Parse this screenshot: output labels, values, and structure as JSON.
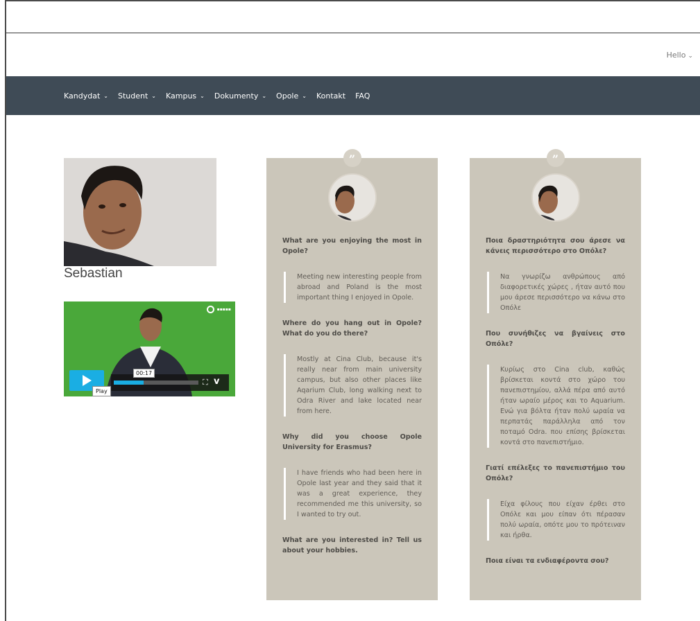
{
  "header": {
    "hello_label": "Hello"
  },
  "nav": {
    "items": [
      {
        "label": "Kandydat",
        "dropdown": true
      },
      {
        "label": "Student",
        "dropdown": true
      },
      {
        "label": "Kampus",
        "dropdown": true
      },
      {
        "label": "Dokumenty",
        "dropdown": true
      },
      {
        "label": "Opole",
        "dropdown": true
      },
      {
        "label": "Kontakt",
        "dropdown": false
      },
      {
        "label": "FAQ",
        "dropdown": false
      }
    ]
  },
  "profile": {
    "name": "Sebastian"
  },
  "video": {
    "time": "00:17",
    "play_tooltip": "Play",
    "progress": 0.35
  },
  "card_en": {
    "items": [
      {
        "q": "What are you enjoying the most in Opole?",
        "a": "Meeting new interesting people from abroad and Poland is the most important thing I enjoyed in Opole."
      },
      {
        "q": "Where do you hang out in Opole? What do you do there?",
        "a": "Mostly at Cina Club, because it's really near from main university campus, but also other places like Aqarium Club, long walking next to Odra River and lake located near from here."
      },
      {
        "q": "Why did you choose Opole University for Erasmus?",
        "a": "I have friends who had been here in Opole last year and they said that it was a great experience, they recommended me this university, so I wanted to try out."
      },
      {
        "q": "What are you interested in? Tell us about your hobbies.",
        "a": ""
      }
    ]
  },
  "card_gr": {
    "items": [
      {
        "q": "Ποια δραστηριότητα σου άρεσε να κάνεις περισσότερο στο Οπόλε?",
        "a": "Να γνωρίζω ανθρώπους από διαφορετικές χώρες , ήταν αυτό που μου άρεσε περισσότερο να κάνω στο Οπόλε"
      },
      {
        "q": "Που συνήθιζες να βγαίνεις στο Οπόλε?",
        "a": "Κυρίως στο Cina club, καθώς βρίσκεται κοντά στο χώρο του πανεπιστημίου, αλλά πέρα από αυτό ήταν ωραίο μέρος και το Aquarium. Ενώ για βόλτα ήταν πολύ ωραία να περπατάς παράλληλα από τον ποταμό Odra. που επίσης βρίσκεται κοντά στο πανεπιστήμιο."
      },
      {
        "q": "Γιατί επέλεξες το πανεπιστήμιο του Οπόλε?",
        "a": "Είχα φίλους που είχαν έρθει στο Οπόλε και μου είπαν ότι πέρασαν πολύ ωραία, οπότε μου το πρότειναν και ήρθα."
      },
      {
        "q": "Ποια είναι τα ενδιαφέροντα σου?",
        "a": ""
      }
    ]
  },
  "colors": {
    "nav_bg": "#3f4b56",
    "card_bg": "#cbc6ba",
    "video_accent": "#1aaee3"
  }
}
